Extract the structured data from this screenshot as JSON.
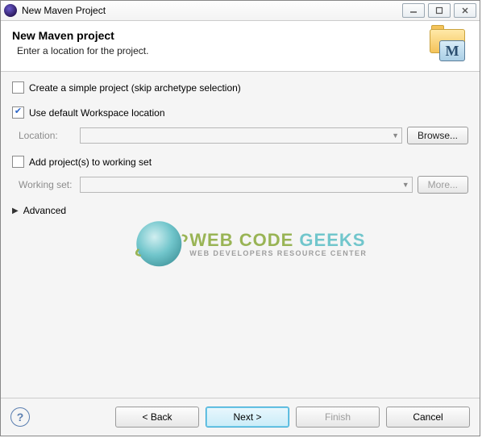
{
  "window": {
    "title": "New Maven Project"
  },
  "header": {
    "title": "New Maven project",
    "subtitle": "Enter a location for the project."
  },
  "options": {
    "simple_project": {
      "label": "Create a simple project (skip archetype selection)",
      "checked": false
    },
    "use_default_ws": {
      "label": "Use default Workspace location",
      "checked": true
    },
    "add_to_working_set": {
      "label": "Add project(s) to working set",
      "checked": false
    }
  },
  "fields": {
    "location": {
      "label": "Location:",
      "value": "",
      "browse": "Browse..."
    },
    "working_set": {
      "label": "Working set:",
      "value": "",
      "more": "More..."
    }
  },
  "advanced": {
    "label": "Advanced"
  },
  "watermark": {
    "line1a": "WEB CODE ",
    "line1b": "GEEKS",
    "line2": "WEB DEVELOPERS RESOURCE CENTER"
  },
  "footer": {
    "back": "< Back",
    "next": "Next >",
    "finish": "Finish",
    "cancel": "Cancel"
  }
}
